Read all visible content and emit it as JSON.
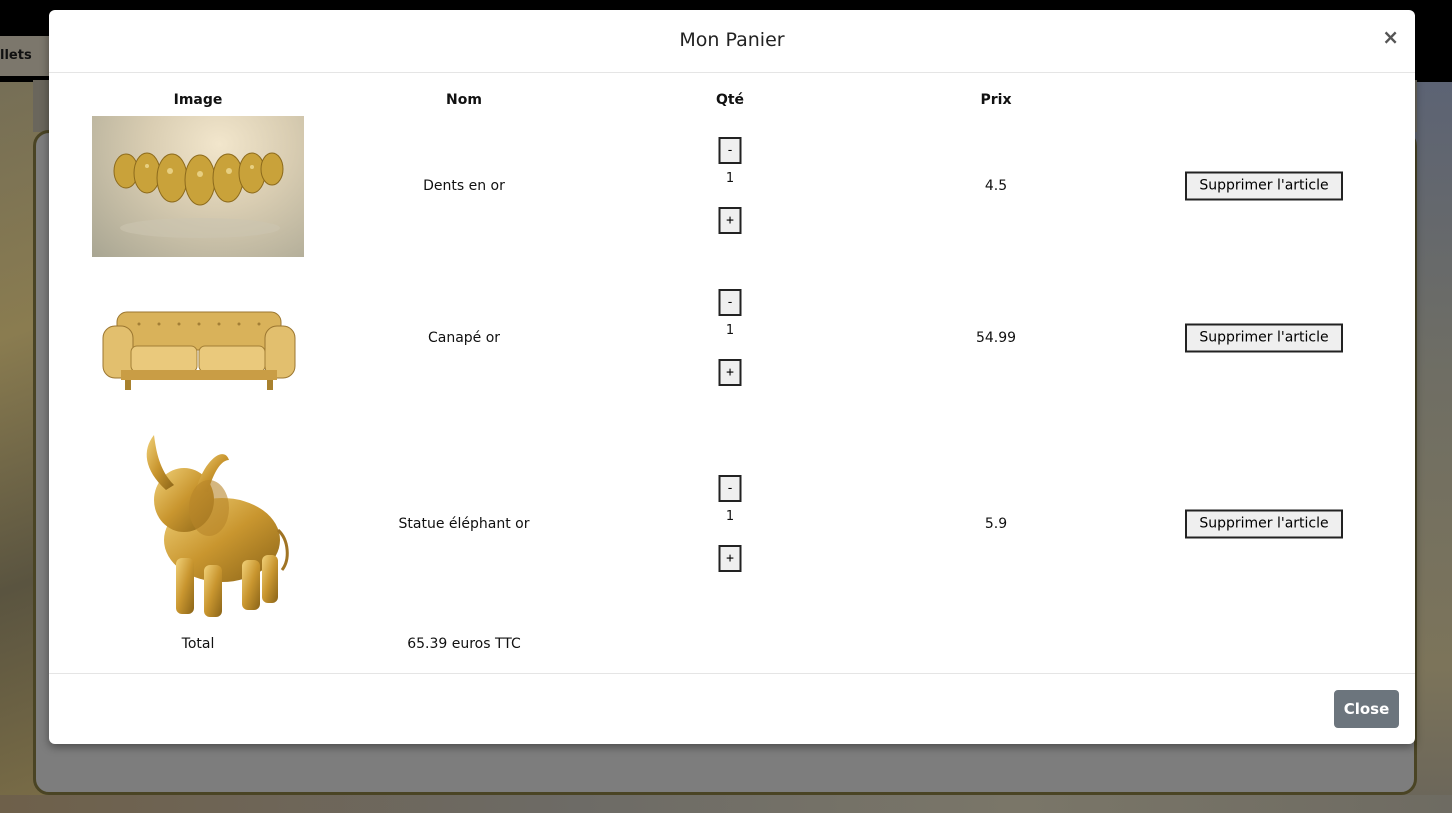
{
  "background": {
    "partial_label": "llets"
  },
  "modal": {
    "title": "Mon Panier",
    "close_symbol": "×",
    "columns": [
      "Image",
      "Nom",
      "Qté",
      "Prix"
    ],
    "items": [
      {
        "name": "Dents en or",
        "image_icon": "gold-teeth-image",
        "quantity": "1",
        "price": "4.5",
        "minus": "-",
        "plus": "+",
        "delete_label": "Supprimer l'article"
      },
      {
        "name": "Canapé or",
        "image_icon": "gold-sofa-image",
        "quantity": "1",
        "price": "54.99",
        "minus": "-",
        "plus": "+",
        "delete_label": "Supprimer l'article"
      },
      {
        "name": "Statue éléphant or",
        "image_icon": "gold-elephant-image",
        "quantity": "1",
        "price": "5.9",
        "minus": "-",
        "plus": "+",
        "delete_label": "Supprimer l'article"
      }
    ],
    "total_label": "Total",
    "total_value": "65.39 euros TTC",
    "footer_close": "Close"
  },
  "colors": {
    "close_button": "#6c757d",
    "gold": "#d4a93a"
  }
}
